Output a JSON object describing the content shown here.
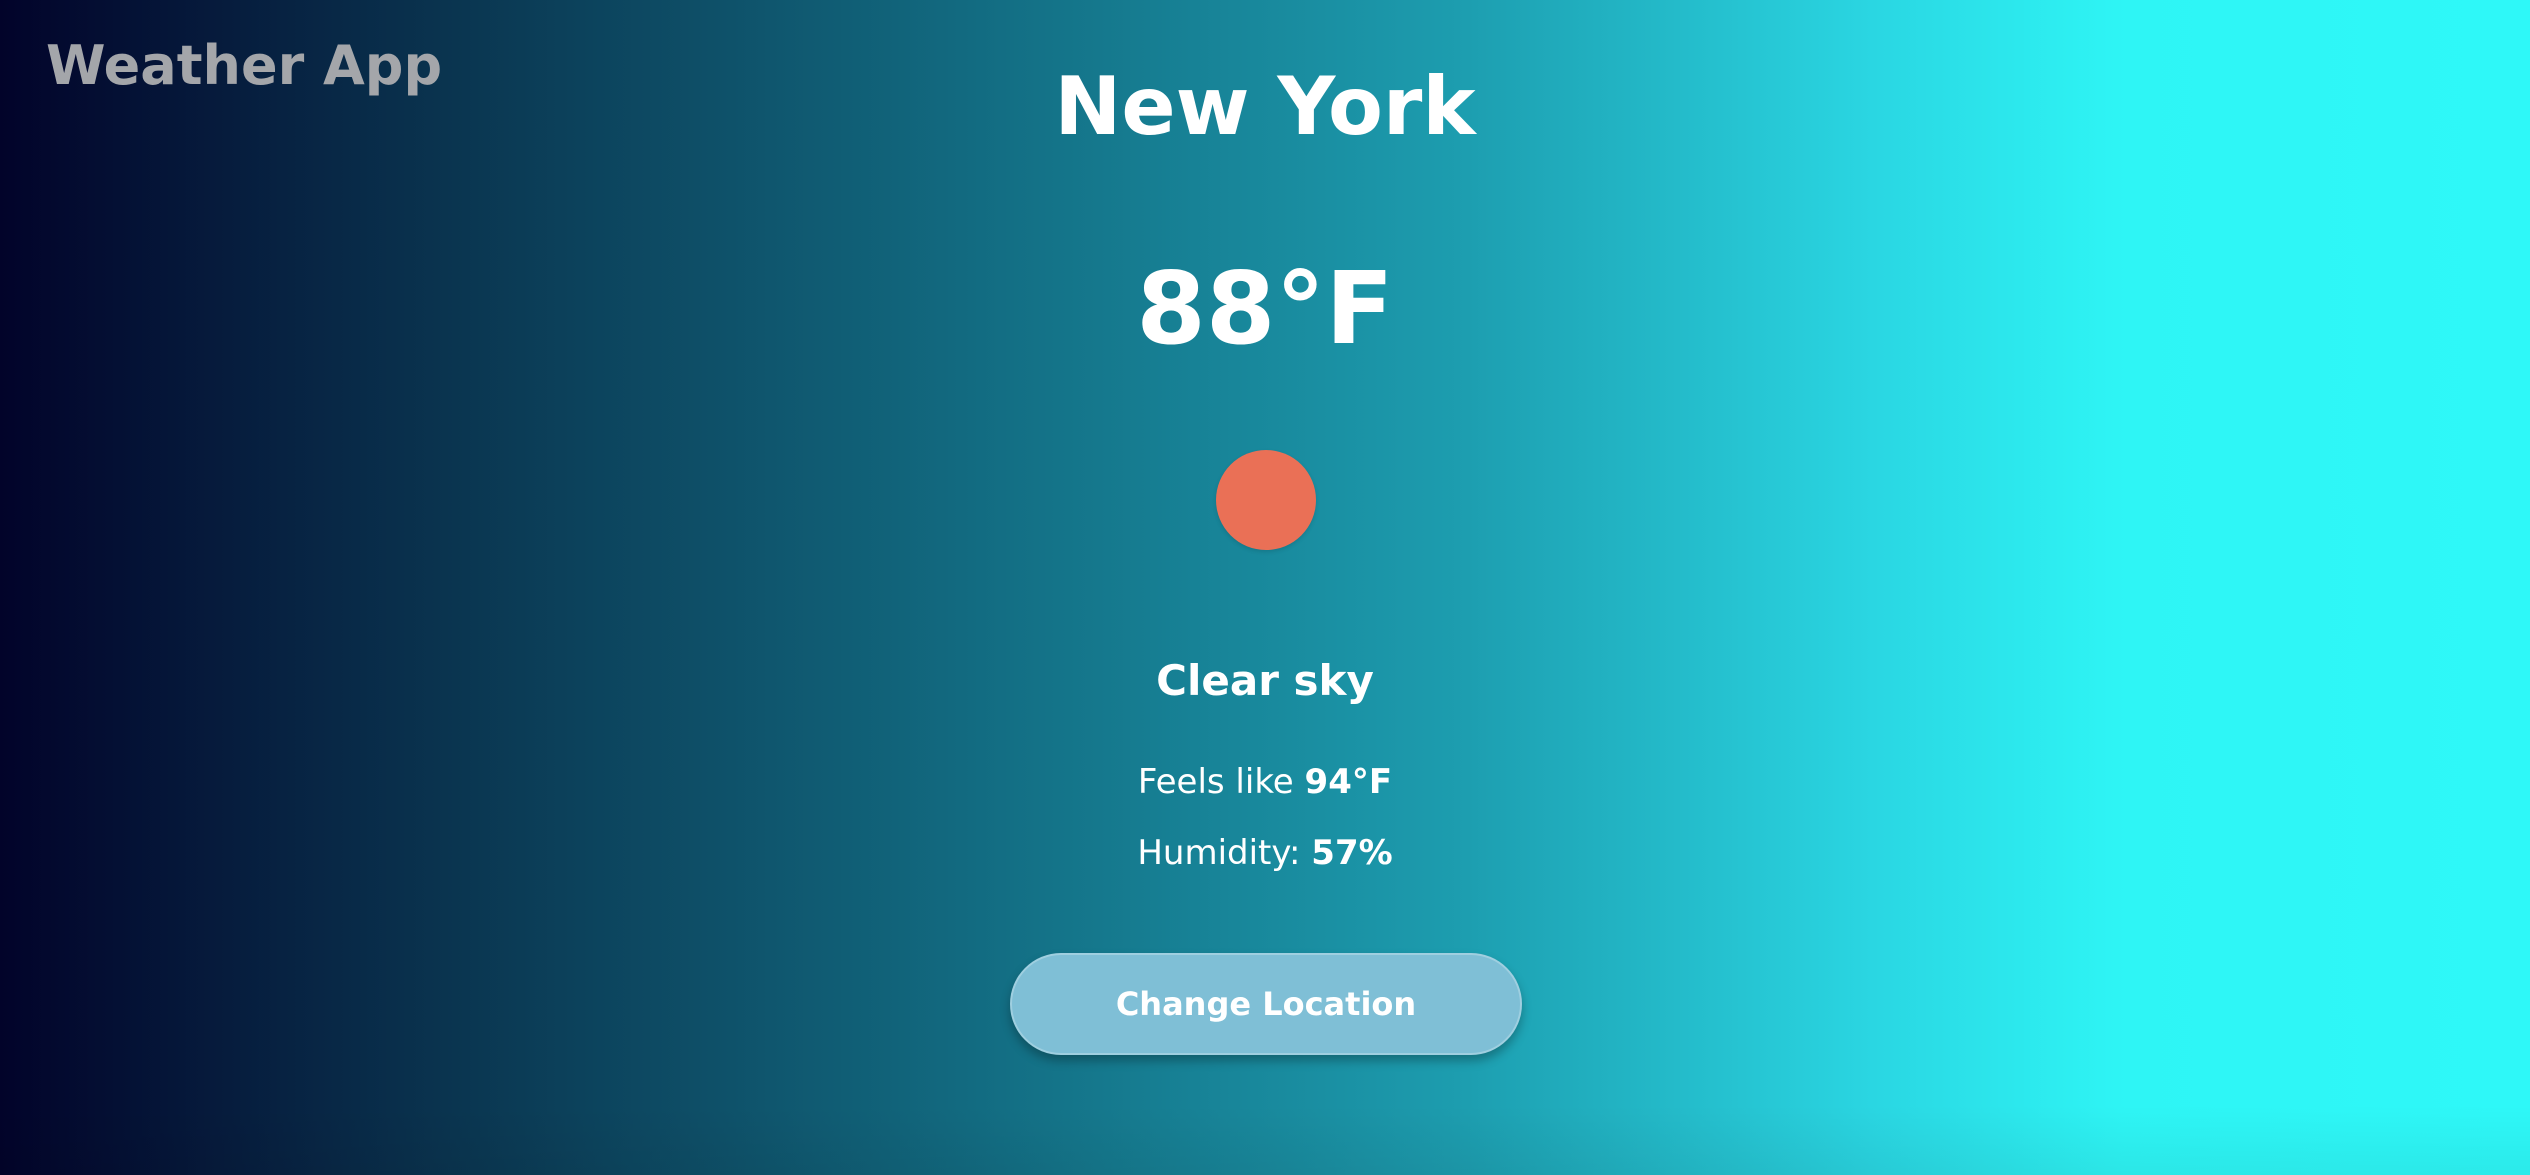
{
  "header": {
    "app_title": "Weather App"
  },
  "weather": {
    "city": "New York",
    "temperature": "88°F",
    "condition_icon": "sun-icon",
    "condition": "Clear sky",
    "feels_like_label": "Feels like",
    "feels_like_value": "94°F",
    "humidity_label": "Humidity:",
    "humidity_value": "57%"
  },
  "actions": {
    "change_location_label": "Change Location"
  },
  "colors": {
    "sun": "#ea7056",
    "button": "#7fbfd6",
    "app_title": "#a4a6aa",
    "gradient_start": "#02032a",
    "gradient_end": "#2ef8f8"
  }
}
